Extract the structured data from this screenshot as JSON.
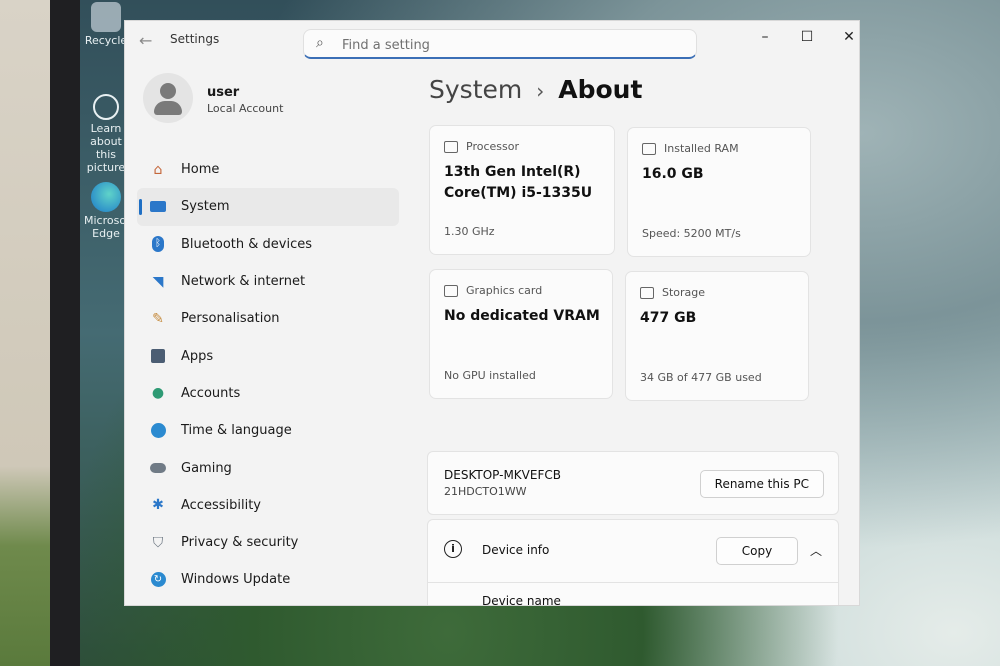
{
  "window": {
    "title": "Settings",
    "search_placeholder": "Find a setting",
    "controls": {
      "minimize": "–",
      "maximize": "☐",
      "close": "✕"
    }
  },
  "desktop_icons": [
    {
      "label": "Recycle",
      "icon": "recycle-bin-icon"
    },
    {
      "label": "Learn about this picture",
      "icon": "learn-picture-icon"
    },
    {
      "label": "Microsoft Edge",
      "icon": "edge-icon"
    }
  ],
  "user": {
    "name": "user",
    "account_type": "Local Account"
  },
  "sidebar": {
    "items": [
      {
        "label": "Home",
        "icon": "home-icon",
        "active": false
      },
      {
        "label": "System",
        "icon": "system-icon",
        "active": true
      },
      {
        "label": "Bluetooth & devices",
        "icon": "bluetooth-icon",
        "active": false
      },
      {
        "label": "Network & internet",
        "icon": "wifi-icon",
        "active": false
      },
      {
        "label": "Personalisation",
        "icon": "brush-icon",
        "active": false
      },
      {
        "label": "Apps",
        "icon": "apps-icon",
        "active": false
      },
      {
        "label": "Accounts",
        "icon": "accounts-icon",
        "active": false
      },
      {
        "label": "Time & language",
        "icon": "globe-icon",
        "active": false
      },
      {
        "label": "Gaming",
        "icon": "gamepad-icon",
        "active": false
      },
      {
        "label": "Accessibility",
        "icon": "accessibility-icon",
        "active": false
      },
      {
        "label": "Privacy & security",
        "icon": "shield-icon",
        "active": false
      },
      {
        "label": "Windows Update",
        "icon": "update-icon",
        "active": false
      }
    ]
  },
  "breadcrumb": {
    "parent": "System",
    "separator": "›",
    "current": "About"
  },
  "specs": {
    "processor": {
      "heading": "Processor",
      "value": "13th Gen Intel(R) Core(TM) i5-1335U",
      "footer": "1.30 GHz"
    },
    "ram": {
      "heading": "Installed RAM",
      "value": "16.0 GB",
      "footer": "Speed: 5200 MT/s"
    },
    "graphics": {
      "heading": "Graphics card",
      "value": "No dedicated VRAM",
      "footer": "No GPU installed"
    },
    "storage": {
      "heading": "Storage",
      "value": "477 GB",
      "footer": "34 GB of 477 GB used"
    }
  },
  "device": {
    "name": "DESKTOP-MKVEFCB",
    "model": "21HDCTO1WW",
    "rename_button": "Rename this PC"
  },
  "device_info": {
    "label": "Device info",
    "copy_button": "Copy",
    "first_row_label": "Device name"
  },
  "colors": {
    "accent": "#1f6fc4",
    "window_bg": "#f3f3f3",
    "card_bg": "#fbfbfb"
  }
}
